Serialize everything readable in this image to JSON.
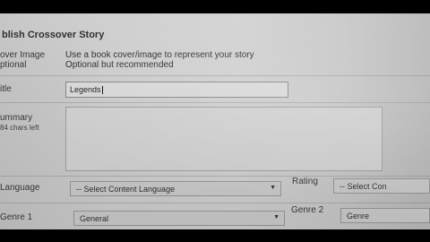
{
  "form": {
    "title": "blish Crossover Story",
    "cover_image": {
      "label_line1": "over Image",
      "label_line2": "ptional",
      "help_line1": "Use a book cover/image to represent your story",
      "help_line2": "Optional but recommended"
    },
    "title_field": {
      "label": "itle",
      "value": "Legends"
    },
    "summary": {
      "label": "ummary",
      "chars_left": "84 chars left"
    },
    "language": {
      "label": "Language",
      "selected": "-- Select Content Language"
    },
    "rating": {
      "label": "Rating",
      "selected": "-- Select Con"
    },
    "genre1": {
      "label": "Genre 1",
      "selected": "General"
    },
    "genre2": {
      "label": "Genre 2",
      "selected": "Genre"
    }
  },
  "icons": {
    "dropdown": "chevron-down-icon",
    "text_cursor": "text-cursor-icon"
  }
}
